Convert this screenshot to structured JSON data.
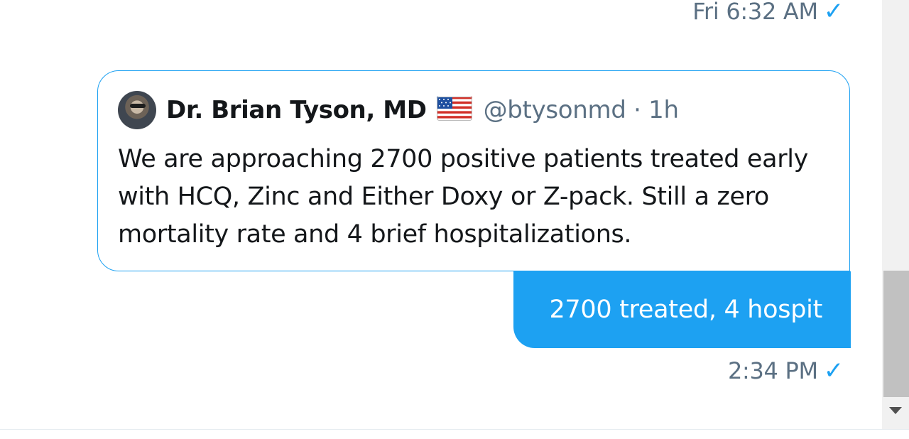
{
  "messages": {
    "first_time": "Fri 6:32 AM",
    "quote": {
      "name": "Dr. Brian Tyson, MD",
      "handle_time": "@btysonmd · 1h",
      "text": "We are approaching 2700 positive patients treated early with HCQ, Zinc and Either Doxy or Z-pack.  Still a zero mortality rate and 4 brief hospitalizations."
    },
    "reply_text": "2700 treated, 4 hospit",
    "reply_time": "2:34 PM"
  },
  "icons": {
    "sent_check": "checkmark-icon",
    "flag": "us-flag-emoji",
    "scroll_down": "scroll-down-arrow-icon"
  },
  "colors": {
    "accent": "#1da1f2",
    "muted": "#5b7083",
    "text": "#14171a"
  }
}
